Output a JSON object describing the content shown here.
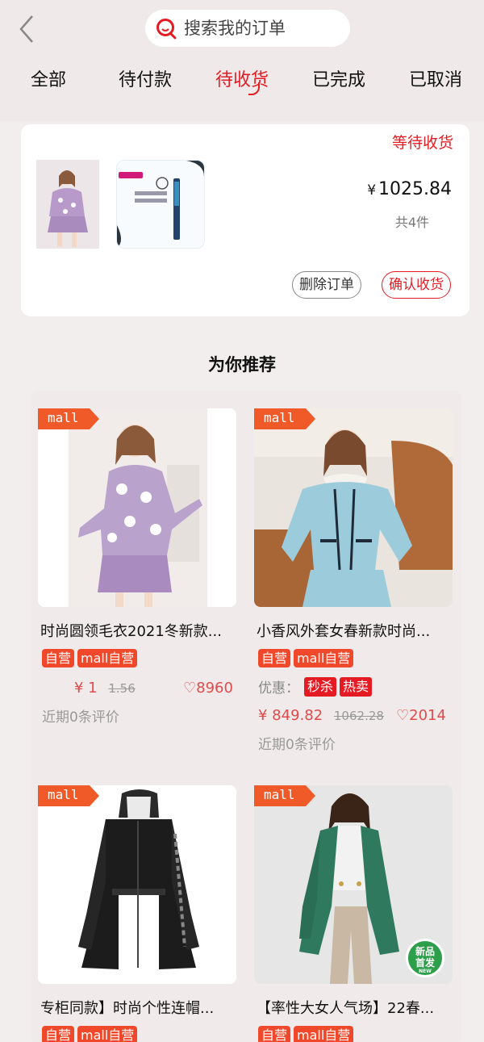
{
  "search": {
    "placeholder": "搜索我的订单"
  },
  "tabs": [
    "全部",
    "待付款",
    "待收货",
    "已完成",
    "已取消"
  ],
  "order": {
    "status": "等待收货",
    "currency": "¥",
    "price": "1025.84",
    "count": "共4件",
    "thumb2_label": "防水卷翘\n不易晕染",
    "delete_label": "删除订单",
    "confirm_label": "确认收货"
  },
  "recommend": {
    "title": "为你推荐",
    "mall_tag": "mall",
    "items": [
      {
        "name": "时尚圆领毛衣2021冬新款...",
        "badges": [
          "自营",
          "mall自营"
        ],
        "price": "¥ 1",
        "old_price": "1.56",
        "likes": "♡8960",
        "reviews": "近期0条评价"
      },
      {
        "name": "小香风外套女春新款时尚...",
        "badges": [
          "自营",
          "mall自营"
        ],
        "promo_label": "优惠：",
        "promo_tags": [
          "秒杀",
          "热卖"
        ],
        "price": "¥ 849.82",
        "old_price": "1062.28",
        "likes": "♡2014",
        "reviews": "近期0条评价"
      },
      {
        "name": "专柜同款】时尚个性连帽...",
        "badges": [
          "自营",
          "mall自营"
        ]
      },
      {
        "name": "【率性大女人气场】22春...",
        "badges": [
          "自营",
          "mall自营"
        ],
        "new_badge": [
          "新品",
          "首发",
          "NEW"
        ]
      }
    ]
  },
  "colors": {
    "accent": "#e41b23",
    "badge": "#f0482a",
    "price": "#e24b4b"
  }
}
